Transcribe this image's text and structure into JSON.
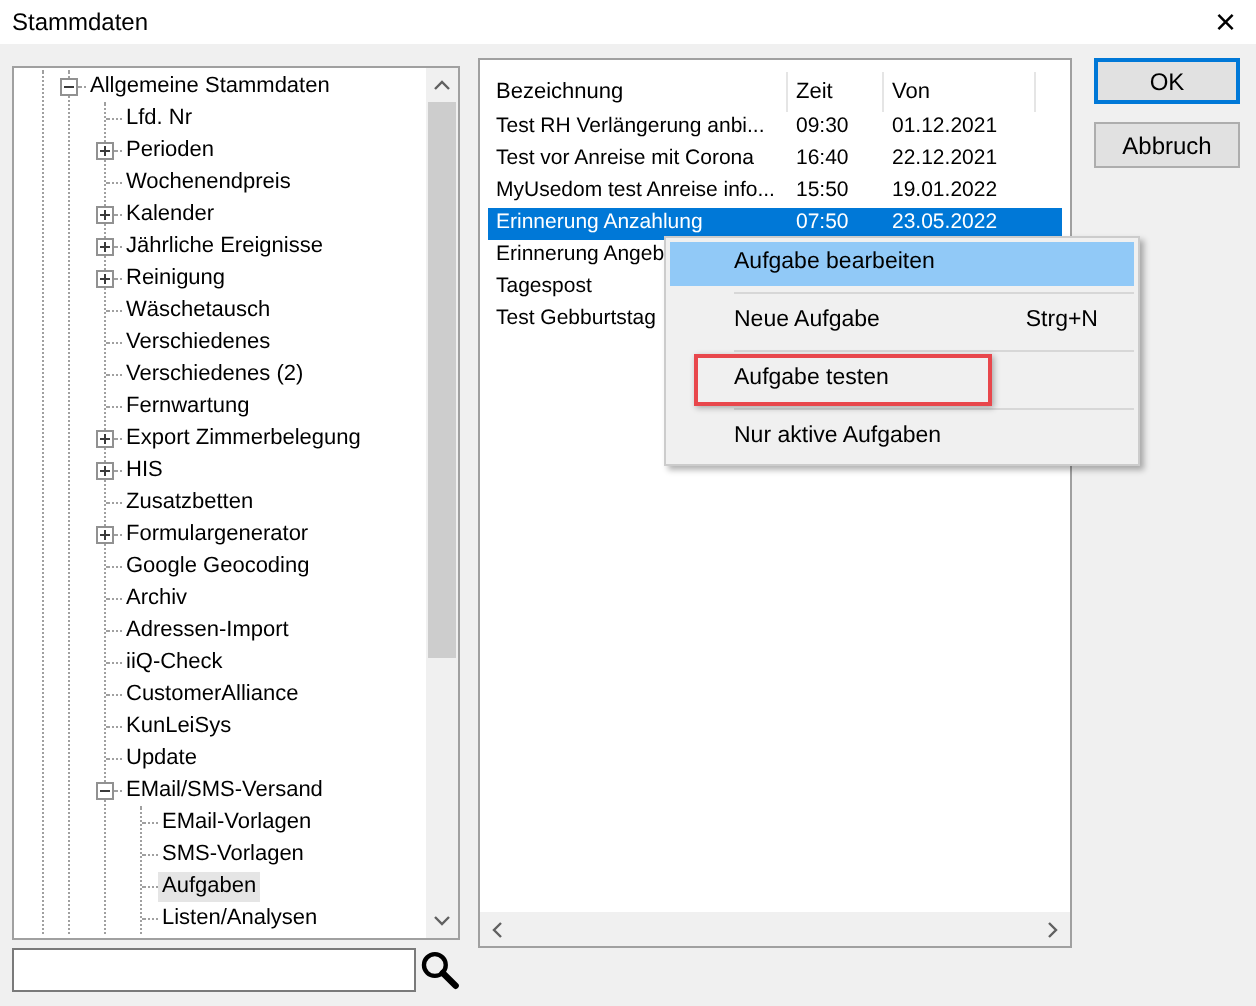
{
  "window": {
    "title": "Stammdaten",
    "close": "×"
  },
  "tree": [
    {
      "label": "Allgemeine Stammdaten",
      "expanded": true,
      "selected": false,
      "children": [
        {
          "label": "Lfd. Nr",
          "selected": false
        },
        {
          "label": "Perioden",
          "expanded": false,
          "selected": false
        },
        {
          "label": "Wochenendpreis",
          "selected": false
        },
        {
          "label": "Kalender",
          "expanded": false,
          "selected": false
        },
        {
          "label": "Jährliche Ereignisse",
          "expanded": false,
          "selected": false
        },
        {
          "label": "Reinigung",
          "expanded": false,
          "selected": false
        },
        {
          "label": "Wäschetausch",
          "selected": false
        },
        {
          "label": "Verschiedenes",
          "selected": false
        },
        {
          "label": "Verschiedenes (2)",
          "selected": false
        },
        {
          "label": "Fernwartung",
          "selected": false
        },
        {
          "label": "Export Zimmerbelegung",
          "expanded": false,
          "selected": false
        },
        {
          "label": "HIS",
          "expanded": false,
          "selected": false
        },
        {
          "label": "Zusatzbetten",
          "selected": false
        },
        {
          "label": "Formulargenerator",
          "expanded": false,
          "selected": false
        },
        {
          "label": "Google Geocoding",
          "selected": false
        },
        {
          "label": "Archiv",
          "selected": false
        },
        {
          "label": "Adressen-Import",
          "selected": false
        },
        {
          "label": "iiQ-Check",
          "selected": false
        },
        {
          "label": "CustomerAlliance",
          "selected": false
        },
        {
          "label": "KunLeiSys",
          "selected": false
        },
        {
          "label": "Update",
          "selected": false
        },
        {
          "label": "EMail/SMS-Versand",
          "expanded": true,
          "selected": false,
          "children": [
            {
              "label": "EMail-Vorlagen",
              "selected": false
            },
            {
              "label": "SMS-Vorlagen",
              "selected": false
            },
            {
              "label": "Aufgaben",
              "selected": true
            },
            {
              "label": "Listen/Analysen",
              "selected": false
            }
          ]
        }
      ]
    }
  ],
  "table": {
    "columns": [
      "Bezeichnung",
      "Zeit",
      "Von"
    ],
    "rows": [
      {
        "cells": [
          "Test RH Verlängerung anbi...",
          "09:30",
          "01.12.2021"
        ],
        "selected": false
      },
      {
        "cells": [
          "Test vor Anreise mit Corona",
          "16:40",
          "22.12.2021"
        ],
        "selected": false
      },
      {
        "cells": [
          "MyUsedom test Anreise info...",
          "15:50",
          "19.01.2022"
        ],
        "selected": false
      },
      {
        "cells": [
          "Erinnerung Anzahlung",
          "07:50",
          "23.05.2022"
        ],
        "selected": true
      },
      {
        "cells": [
          "Erinnerung Angeb"
        ],
        "selected": false
      },
      {
        "cells": [
          "Tagespost"
        ],
        "selected": false
      },
      {
        "cells": [
          "Test Gebburtstag"
        ],
        "selected": false
      }
    ]
  },
  "context_menu": [
    {
      "label": "Aufgabe bearbeiten",
      "selected": true,
      "marked": false
    },
    {
      "label": "Neue Aufgabe",
      "shortcut": "Strg+N",
      "selected": false,
      "marked": false
    },
    {
      "label": "Aufgabe testen",
      "selected": false,
      "marked": true
    },
    {
      "label": "Nur aktive Aufgaben",
      "selected": false,
      "marked": false
    }
  ],
  "buttons": [
    {
      "label": "OK",
      "default": true
    },
    {
      "label": "Abbruch",
      "default": false
    }
  ]
}
